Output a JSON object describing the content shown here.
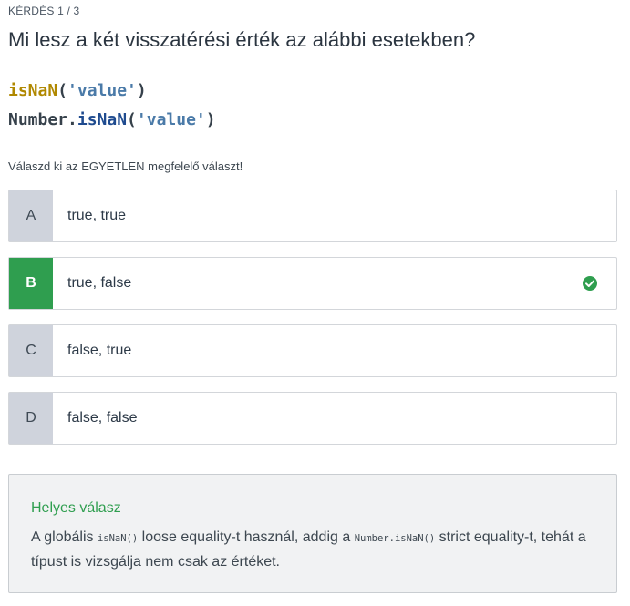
{
  "question": {
    "counter": "KÉRDÉS 1 / 3",
    "title": "Mi lesz a két visszatérési érték az alábbi esetekben?",
    "code_line1": {
      "fn": "isNaN",
      "open": "(",
      "arg": "'value'",
      "close": ")"
    },
    "code_line2": {
      "obj": "Number.",
      "fn": "isNaN",
      "open": "(",
      "arg": "'value'",
      "close": ")"
    },
    "instruction": "Válaszd ki az EGYETLEN megfelelő választ!"
  },
  "options": [
    {
      "letter": "A",
      "text": "true, true",
      "correct": false
    },
    {
      "letter": "B",
      "text": "true, false",
      "correct": true
    },
    {
      "letter": "C",
      "text": "false, true",
      "correct": false
    },
    {
      "letter": "D",
      "text": "false, false",
      "correct": false
    }
  ],
  "feedback": {
    "title": "Helyes válasz",
    "part1": "A globális ",
    "code1": "isNaN()",
    "part2": " loose equality-t használ, addig a ",
    "code2": "Number.isNaN()",
    "part3": " strict equality-t, tehát a típust is vizsgálja nem csak az értéket."
  },
  "colors": {
    "correct": "#2f9e4f",
    "letter_bg": "#cfd3dc",
    "fn_gold": "#b08800",
    "fn_blue": "#1f4b8f",
    "string": "#4a7aa8"
  },
  "icons": {
    "correct_mark": "check-circle-icon"
  }
}
